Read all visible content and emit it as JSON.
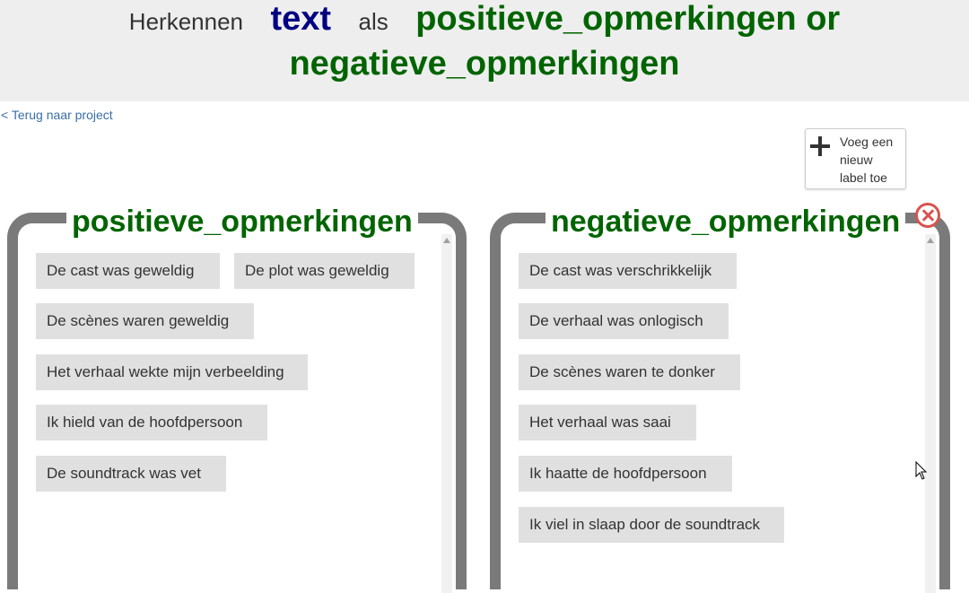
{
  "header": {
    "herkennen": "Herkennen",
    "text": "text",
    "als": "als",
    "labels_line1": "positieve_opmerkingen or",
    "labels_line2": "negatieve_opmerkingen"
  },
  "back_link": "< Terug naar project",
  "add_label_button": "Voeg een nieuw label toe",
  "buckets": [
    {
      "title": "positieve_opmerkingen",
      "items": [
        "De cast was geweldig",
        "De plot was geweldig",
        "De scènes waren geweldig",
        "Het verhaal wekte mijn verbeelding",
        "Ik hield van de hoofdpersoon",
        "De soundtrack was vet"
      ]
    },
    {
      "title": "negatieve_opmerkingen",
      "items": [
        "De cast was verschrikkelijk",
        "De verhaal was onlogisch",
        "De scènes waren te donker",
        "Het verhaal was saai",
        "Ik haatte de hoofdpersoon",
        "Ik viel in slaap door de soundtrack"
      ]
    }
  ],
  "colors": {
    "label_green": "#006400",
    "text_navy": "#000080",
    "bucket_border": "#7a7a7a",
    "chip_bg": "#e0e0e0"
  }
}
